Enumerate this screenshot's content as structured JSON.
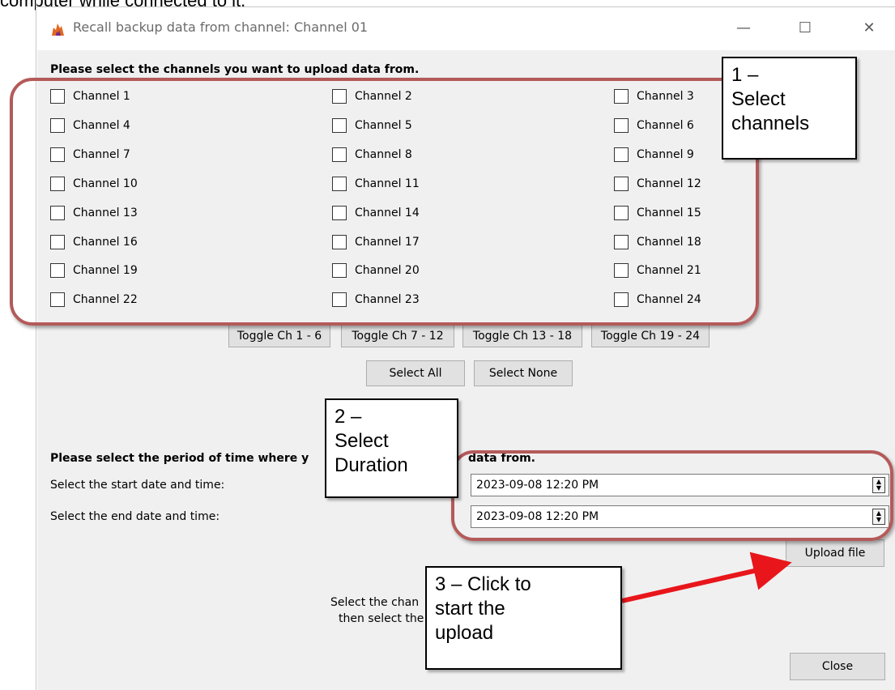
{
  "page": {
    "top_text": "computer while connected to it."
  },
  "window": {
    "title": "Recall backup data from channel: Channel 01",
    "controls": {
      "minimize": "—",
      "maximize": "☐",
      "close": "✕"
    }
  },
  "channels": {
    "heading": "Please select the channels you want to upload data from.",
    "items": [
      "Channel 1",
      "Channel 2",
      "Channel 3",
      "Channel 4",
      "Channel 5",
      "Channel 6",
      "Channel 7",
      "Channel 8",
      "Channel 9",
      "Channel 10",
      "Channel 11",
      "Channel 12",
      "Channel 13",
      "Channel 14",
      "Channel 15",
      "Channel 16",
      "Channel 17",
      "Channel 18",
      "Channel 19",
      "Channel 20",
      "Channel 21",
      "Channel 22",
      "Channel 23",
      "Channel 24"
    ],
    "toggle_buttons": [
      "Toggle Ch 1 - 6",
      "Toggle Ch 7 - 12",
      "Toggle Ch 13 - 18",
      "Toggle Ch 19 - 24"
    ],
    "select_all": "Select All",
    "select_none": "Select None"
  },
  "period": {
    "heading_left": "Please select the period of time where y",
    "heading_right": "data from.",
    "start_label": "Select the start date and time:",
    "end_label": "Select the end date and time:",
    "start_value": "2023-09-08 12:20 PM",
    "end_value": "2023-09-08 12:20 PM",
    "upload_button": "Upload file"
  },
  "hint": {
    "line1": "Select the chan",
    "line2": "then select the"
  },
  "close_button": "Close",
  "annotations": {
    "step1": "1 –\nSelect\nchannels",
    "step2": "2 –\nSelect\nDuration",
    "step3": "3 – Click to\nstart the\nupload",
    "highlight_color": "#b45a5a",
    "arrow_color": "#e8161b"
  }
}
